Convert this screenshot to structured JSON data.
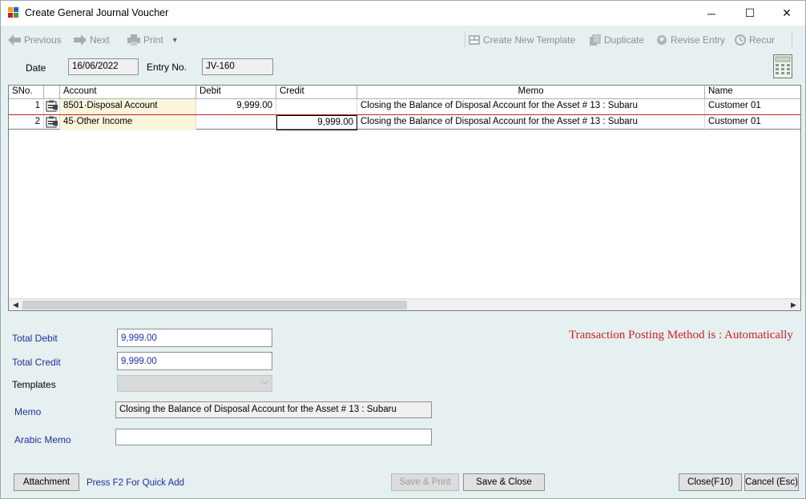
{
  "window": {
    "title": "Create General Journal Voucher",
    "minimize": "─",
    "maximize": "☐",
    "close": "✕"
  },
  "toolbar": {
    "previous": "Previous",
    "next": "Next",
    "print": "Print",
    "create_template": "Create New Template",
    "duplicate": "Duplicate",
    "revise": "Revise Entry",
    "recur": "Recur"
  },
  "header": {
    "date_label": "Date",
    "date_value": "16/06/2022",
    "entry_label": "Entry No.",
    "entry_value": "JV-160"
  },
  "grid": {
    "columns": [
      "SNo.",
      "",
      "Account",
      "Debit",
      "Credit",
      "Memo",
      "Name"
    ],
    "rows": [
      {
        "sno": "1",
        "account": "8501·Disposal Account",
        "debit": "9,999.00",
        "credit": "",
        "memo": "Closing the Balance of Disposal Account for the Asset # 13 : Subaru",
        "name": "Customer 01"
      },
      {
        "sno": "2",
        "account": "45·Other Income",
        "debit": "",
        "credit": "9,999.00",
        "memo": "Closing the Balance of Disposal Account for the Asset # 13 : Subaru",
        "name": "Customer 01"
      }
    ]
  },
  "totals": {
    "debit_label": "Total Debit",
    "debit_value": "9,999.00",
    "credit_label": "Total Credit",
    "credit_value": "9,999.00"
  },
  "templates_label": "Templates",
  "memo": {
    "label": "Memo",
    "value": "Closing the Balance of Disposal Account for the Asset # 13 : Subaru",
    "arabic_label": "Arabic Memo",
    "arabic_value": ""
  },
  "posting_method": "Transaction Posting Method is : Automatically",
  "footer": {
    "attachment": "Attachment",
    "hint": "Press F2 For Quick Add",
    "save_print": "Save & Print",
    "save_close": "Save & Close",
    "close": "Close(F10)",
    "cancel": "Cancel (Esc)"
  },
  "colors": {
    "background": "#e6f0f0",
    "label_blue": "#1f2fa0",
    "posting_red": "#d0202a",
    "account_cell": "#fbf5dc"
  }
}
